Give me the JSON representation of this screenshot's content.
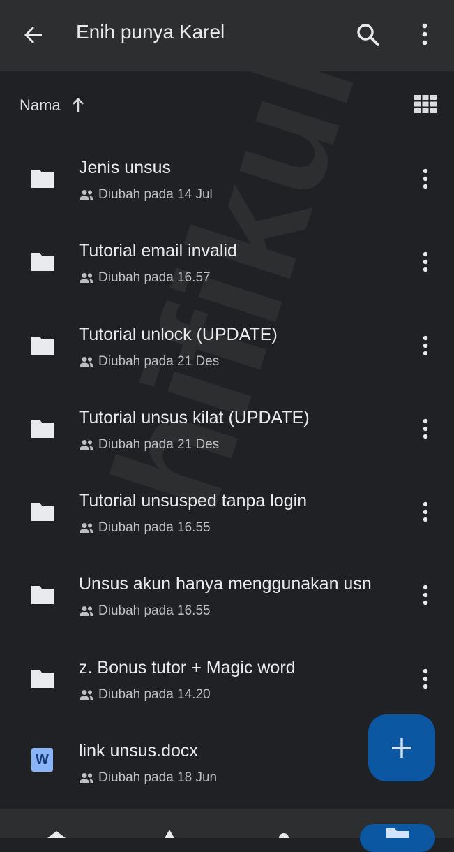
{
  "appbar": {
    "title": "Enih punya Karel",
    "back_icon": "arrow-back-icon",
    "search_icon": "search-icon",
    "more_icon": "more-vert-icon"
  },
  "sort": {
    "label": "Nama",
    "direction_icon": "arrow-up-icon",
    "view_icon": "grid-view-icon"
  },
  "items": [
    {
      "name": "Jenis unsus",
      "meta": "Diubah pada 14 Jul",
      "type": "folder"
    },
    {
      "name": "Tutorial email invalid",
      "meta": "Diubah pada 16.57",
      "type": "folder"
    },
    {
      "name": "Tutorial unlock (UPDATE)",
      "meta": "Diubah pada 21 Des",
      "type": "folder"
    },
    {
      "name": "Tutorial unsus kilat (UPDATE)",
      "meta": "Diubah pada 21 Des",
      "type": "folder"
    },
    {
      "name": "Tutorial unsusped tanpa login",
      "meta": "Diubah pada 16.55",
      "type": "folder"
    },
    {
      "name": "Unsus akun hanya menggunakan usn",
      "meta": "Diubah pada 16.55",
      "type": "folder"
    },
    {
      "name": "z. Bonus tutor + Magic word",
      "meta": "Diubah pada 14.20",
      "type": "folder"
    },
    {
      "name": "link unsus.docx",
      "meta": "Diubah pada 18 Jun",
      "type": "word",
      "file_badge": "W"
    }
  ],
  "watermark": "hifikuh",
  "colors": {
    "background": "#202124",
    "appbar": "#2d2e30",
    "accent": "#0b57a2",
    "word_icon": "#8ab4f8"
  }
}
